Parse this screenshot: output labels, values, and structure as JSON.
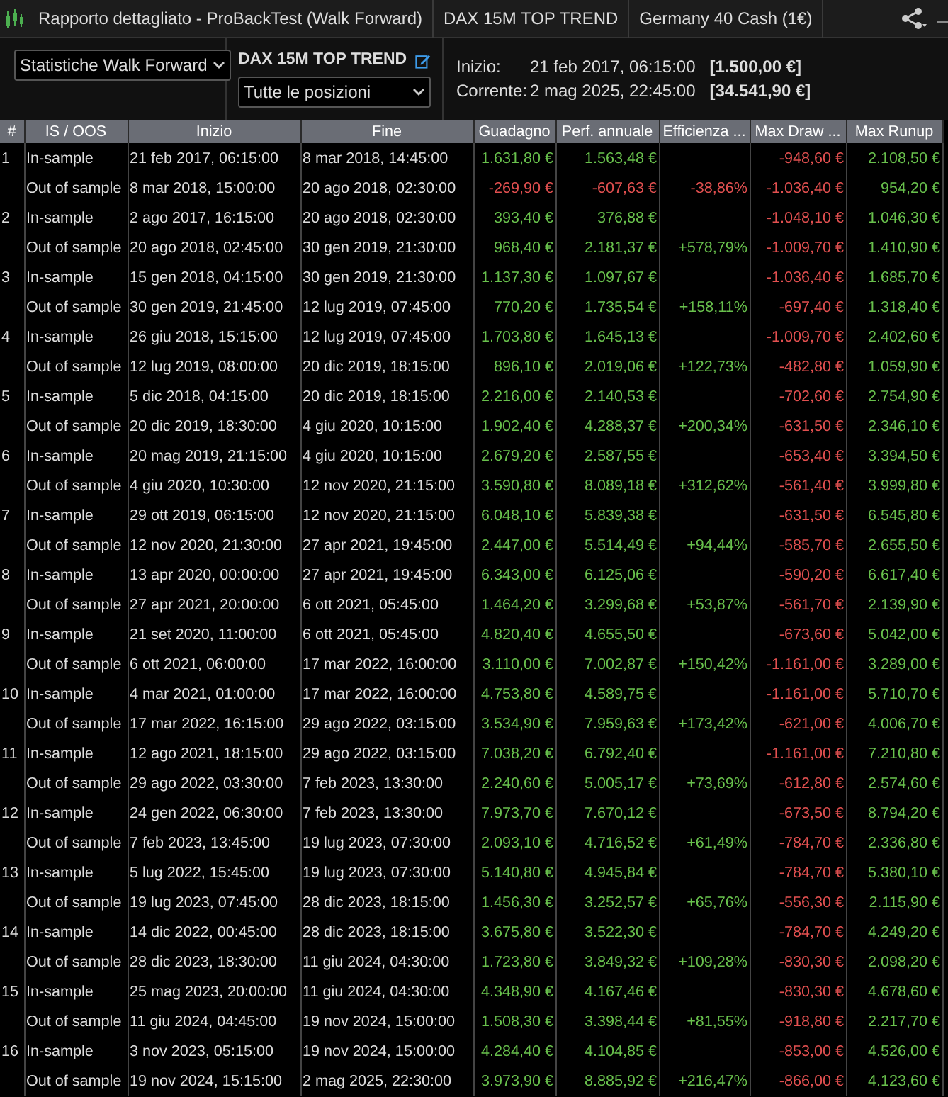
{
  "window": {
    "tabs": [
      "Rapporto dettagliato - ProBackTest (Walk Forward)",
      "DAX 15M TOP TREND",
      "Germany 40 Cash (1€)"
    ]
  },
  "controls": {
    "report_select": "Statistiche Walk Forward",
    "system_name": "DAX 15M TOP TREND",
    "positions_select": "Tutte le posizioni",
    "info": [
      {
        "label": "Inizio:",
        "date": "21 feb 2017, 06:15:00",
        "amount": "[1.500,00 €]"
      },
      {
        "label": "Corrente:",
        "date": "2 mag 2025, 22:45:00",
        "amount": "[34.541,90 €]"
      }
    ]
  },
  "table": {
    "columns": [
      {
        "label": "#",
        "kind": "text"
      },
      {
        "label": "IS / OOS",
        "kind": "text"
      },
      {
        "label": "Inizio",
        "kind": "text"
      },
      {
        "label": "Fine",
        "kind": "text"
      },
      {
        "label": "Guadagno",
        "kind": "number"
      },
      {
        "label": "Perf. annuale",
        "kind": "number"
      },
      {
        "label": "Efficienza ...",
        "kind": "number"
      },
      {
        "label": "Max Draw ...",
        "kind": "loss"
      },
      {
        "label": "Max Runup",
        "kind": "profit"
      }
    ],
    "rows": [
      {
        "number": "1",
        "sample": "In-sample",
        "start": "21 feb 2017, 06:15:00",
        "end": "8 mar 2018, 14:45:00",
        "gain": "1.631,80 €",
        "annual": "1.563,48 €",
        "drawdown": "-948,60 €",
        "runup": "2.108,50 €",
        "negative": false
      },
      {
        "sample": "Out of sample",
        "start": "8 mar 2018, 15:00:00",
        "end": "20 ago 2018, 02:30:00",
        "gain": "-269,90 €",
        "annual": "-607,63 €",
        "efficiency": "-38,86%",
        "drawdown": "-1.036,40 €",
        "runup": "954,20 €",
        "negative": true
      },
      {
        "number": "2",
        "sample": "In-sample",
        "start": "2 ago 2017, 16:15:00",
        "end": "20 ago 2018, 02:30:00",
        "gain": "393,40 €",
        "annual": "376,88 €",
        "drawdown": "-1.048,10 €",
        "runup": "1.046,30 €",
        "negative": false
      },
      {
        "sample": "Out of sample",
        "start": "20 ago 2018, 02:45:00",
        "end": "30 gen 2019, 21:30:00",
        "gain": "968,40 €",
        "annual": "2.181,37 €",
        "efficiency": "+578,79%",
        "drawdown": "-1.009,70 €",
        "runup": "1.410,90 €",
        "negative": false
      },
      {
        "number": "3",
        "sample": "In-sample",
        "start": "15 gen 2018, 04:15:00",
        "end": "30 gen 2019, 21:30:00",
        "gain": "1.137,30 €",
        "annual": "1.097,67 €",
        "drawdown": "-1.036,40 €",
        "runup": "1.685,70 €",
        "negative": false
      },
      {
        "sample": "Out of sample",
        "start": "30 gen 2019, 21:45:00",
        "end": "12 lug 2019, 07:45:00",
        "gain": "770,20 €",
        "annual": "1.735,54 €",
        "efficiency": "+158,11%",
        "drawdown": "-697,40 €",
        "runup": "1.318,40 €",
        "negative": false
      },
      {
        "number": "4",
        "sample": "In-sample",
        "start": "26 giu 2018, 15:15:00",
        "end": "12 lug 2019, 07:45:00",
        "gain": "1.703,80 €",
        "annual": "1.645,13 €",
        "drawdown": "-1.009,70 €",
        "runup": "2.402,60 €",
        "negative": false
      },
      {
        "sample": "Out of sample",
        "start": "12 lug 2019, 08:00:00",
        "end": "20 dic 2019, 18:15:00",
        "gain": "896,10 €",
        "annual": "2.019,06 €",
        "efficiency": "+122,73%",
        "drawdown": "-482,80 €",
        "runup": "1.059,90 €",
        "negative": false
      },
      {
        "number": "5",
        "sample": "In-sample",
        "start": "5 dic 2018, 04:15:00",
        "end": "20 dic 2019, 18:15:00",
        "gain": "2.216,00 €",
        "annual": "2.140,53 €",
        "drawdown": "-702,60 €",
        "runup": "2.754,90 €",
        "negative": false
      },
      {
        "sample": "Out of sample",
        "start": "20 dic 2019, 18:30:00",
        "end": "4 giu 2020, 10:15:00",
        "gain": "1.902,40 €",
        "annual": "4.288,37 €",
        "efficiency": "+200,34%",
        "drawdown": "-631,50 €",
        "runup": "2.346,10 €",
        "negative": false
      },
      {
        "number": "6",
        "sample": "In-sample",
        "start": "20 mag 2019, 21:15:00",
        "end": "4 giu 2020, 10:15:00",
        "gain": "2.679,20 €",
        "annual": "2.587,55 €",
        "drawdown": "-653,40 €",
        "runup": "3.394,50 €",
        "negative": false
      },
      {
        "sample": "Out of sample",
        "start": "4 giu 2020, 10:30:00",
        "end": "12 nov 2020, 21:15:00",
        "gain": "3.590,80 €",
        "annual": "8.089,18 €",
        "efficiency": "+312,62%",
        "drawdown": "-561,40 €",
        "runup": "3.999,80 €",
        "negative": false
      },
      {
        "number": "7",
        "sample": "In-sample",
        "start": "29 ott 2019, 06:15:00",
        "end": "12 nov 2020, 21:15:00",
        "gain": "6.048,10 €",
        "annual": "5.839,38 €",
        "drawdown": "-631,50 €",
        "runup": "6.545,80 €",
        "negative": false
      },
      {
        "sample": "Out of sample",
        "start": "12 nov 2020, 21:30:00",
        "end": "27 apr 2021, 19:45:00",
        "gain": "2.447,00 €",
        "annual": "5.514,49 €",
        "efficiency": "+94,44%",
        "drawdown": "-585,70 €",
        "runup": "2.655,50 €",
        "negative": false
      },
      {
        "number": "8",
        "sample": "In-sample",
        "start": "13 apr 2020, 00:00:00",
        "end": "27 apr 2021, 19:45:00",
        "gain": "6.343,00 €",
        "annual": "6.125,06 €",
        "drawdown": "-590,20 €",
        "runup": "6.617,40 €",
        "negative": false
      },
      {
        "sample": "Out of sample",
        "start": "27 apr 2021, 20:00:00",
        "end": "6 ott 2021, 05:45:00",
        "gain": "1.464,20 €",
        "annual": "3.299,68 €",
        "efficiency": "+53,87%",
        "drawdown": "-561,70 €",
        "runup": "2.139,90 €",
        "negative": false
      },
      {
        "number": "9",
        "sample": "In-sample",
        "start": "21 set 2020, 11:00:00",
        "end": "6 ott 2021, 05:45:00",
        "gain": "4.820,40 €",
        "annual": "4.655,50 €",
        "drawdown": "-673,60 €",
        "runup": "5.042,00 €",
        "negative": false
      },
      {
        "sample": "Out of sample",
        "start": "6 ott 2021, 06:00:00",
        "end": "17 mar 2022, 16:00:00",
        "gain": "3.110,00 €",
        "annual": "7.002,87 €",
        "efficiency": "+150,42%",
        "drawdown": "-1.161,00 €",
        "runup": "3.289,00 €",
        "negative": false
      },
      {
        "number": "10",
        "sample": "In-sample",
        "start": "4 mar 2021, 01:00:00",
        "end": "17 mar 2022, 16:00:00",
        "gain": "4.753,80 €",
        "annual": "4.589,75 €",
        "drawdown": "-1.161,00 €",
        "runup": "5.710,70 €",
        "negative": false
      },
      {
        "sample": "Out of sample",
        "start": "17 mar 2022, 16:15:00",
        "end": "29 ago 2022, 03:15:00",
        "gain": "3.534,90 €",
        "annual": "7.959,63 €",
        "efficiency": "+173,42%",
        "drawdown": "-621,00 €",
        "runup": "4.006,70 €",
        "negative": false
      },
      {
        "number": "11",
        "sample": "In-sample",
        "start": "12 ago 2021, 18:15:00",
        "end": "29 ago 2022, 03:15:00",
        "gain": "7.038,20 €",
        "annual": "6.792,40 €",
        "drawdown": "-1.161,00 €",
        "runup": "7.210,80 €",
        "negative": false
      },
      {
        "sample": "Out of sample",
        "start": "29 ago 2022, 03:30:00",
        "end": "7 feb 2023, 13:30:00",
        "gain": "2.240,60 €",
        "annual": "5.005,17 €",
        "efficiency": "+73,69%",
        "drawdown": "-612,80 €",
        "runup": "2.574,60 €",
        "negative": false
      },
      {
        "number": "12",
        "sample": "In-sample",
        "start": "24 gen 2022, 06:30:00",
        "end": "7 feb 2023, 13:30:00",
        "gain": "7.973,70 €",
        "annual": "7.670,12 €",
        "drawdown": "-673,50 €",
        "runup": "8.794,20 €",
        "negative": false
      },
      {
        "sample": "Out of sample",
        "start": "7 feb 2023, 13:45:00",
        "end": "19 lug 2023, 07:30:00",
        "gain": "2.093,10 €",
        "annual": "4.716,52 €",
        "efficiency": "+61,49%",
        "drawdown": "-784,70 €",
        "runup": "2.336,80 €",
        "negative": false
      },
      {
        "number": "13",
        "sample": "In-sample",
        "start": "5 lug 2022, 15:45:00",
        "end": "19 lug 2023, 07:30:00",
        "gain": "5.140,80 €",
        "annual": "4.945,84 €",
        "drawdown": "-784,70 €",
        "runup": "5.380,10 €",
        "negative": false
      },
      {
        "sample": "Out of sample",
        "start": "19 lug 2023, 07:45:00",
        "end": "28 dic 2023, 18:15:00",
        "gain": "1.456,30 €",
        "annual": "3.252,57 €",
        "efficiency": "+65,76%",
        "drawdown": "-556,30 €",
        "runup": "2.115,90 €",
        "negative": false
      },
      {
        "number": "14",
        "sample": "In-sample",
        "start": "14 dic 2022, 00:45:00",
        "end": "28 dic 2023, 18:15:00",
        "gain": "3.675,80 €",
        "annual": "3.522,30 €",
        "drawdown": "-784,70 €",
        "runup": "4.249,20 €",
        "negative": false
      },
      {
        "sample": "Out of sample",
        "start": "28 dic 2023, 18:30:00",
        "end": "11 giu 2024, 04:30:00",
        "gain": "1.723,80 €",
        "annual": "3.849,32 €",
        "efficiency": "+109,28%",
        "drawdown": "-830,30 €",
        "runup": "2.098,20 €",
        "negative": false
      },
      {
        "number": "15",
        "sample": "In-sample",
        "start": "25 mag 2023, 20:00:00",
        "end": "11 giu 2024, 04:30:00",
        "gain": "4.348,90 €",
        "annual": "4.167,46 €",
        "drawdown": "-830,30 €",
        "runup": "4.678,60 €",
        "negative": false
      },
      {
        "sample": "Out of sample",
        "start": "11 giu 2024, 04:45:00",
        "end": "19 nov 2024, 15:00:00",
        "gain": "1.508,30 €",
        "annual": "3.398,44 €",
        "efficiency": "+81,55%",
        "drawdown": "-918,80 €",
        "runup": "2.217,70 €",
        "negative": false
      },
      {
        "number": "16",
        "sample": "In-sample",
        "start": "3 nov 2023, 05:15:00",
        "end": "19 nov 2024, 15:00:00",
        "gain": "4.284,40 €",
        "annual": "4.104,85 €",
        "drawdown": "-853,00 €",
        "runup": "4.526,00 €",
        "negative": false
      },
      {
        "sample": "Out of sample",
        "start": "19 nov 2024, 15:15:00",
        "end": "2 mag 2025, 22:30:00",
        "gain": "3.973,90 €",
        "annual": "8.885,92 €",
        "efficiency": "+216,47%",
        "drawdown": "-866,00 €",
        "runup": "4.123,60 €",
        "negative": false
      }
    ]
  }
}
